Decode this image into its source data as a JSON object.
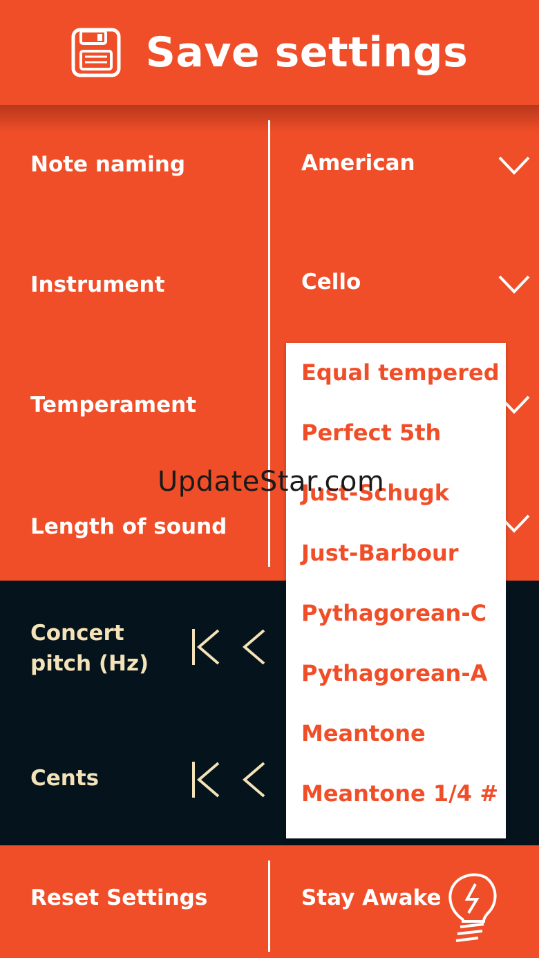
{
  "header": {
    "title": "Save settings",
    "icon": "floppy-disk-icon"
  },
  "settings": {
    "rows": [
      {
        "label": "Note naming",
        "value": "American"
      },
      {
        "label": "Instrument",
        "value": "Cello"
      },
      {
        "label": "Temperament",
        "value": ""
      },
      {
        "label": "Length of sound",
        "value": ""
      }
    ]
  },
  "adjusters": {
    "concert_pitch_line1": "Concert",
    "concert_pitch_line2": "pitch (Hz)",
    "cents": "Cents"
  },
  "dropdown": {
    "items": [
      "Equal tempered",
      "Perfect 5th",
      "Just-Schugk",
      "Just-Barbour",
      "Pythagorean-C",
      "Pythagorean-A",
      "Meantone",
      "Meantone 1/4 #"
    ]
  },
  "bottom": {
    "reset_label": "Reset Settings",
    "stay_awake_label": "Stay Awake"
  },
  "watermark": "UpdateStar.com",
  "colors": {
    "accent": "#f04e28",
    "dark_panel": "#05131d",
    "cream_text": "#f4e3b8"
  }
}
